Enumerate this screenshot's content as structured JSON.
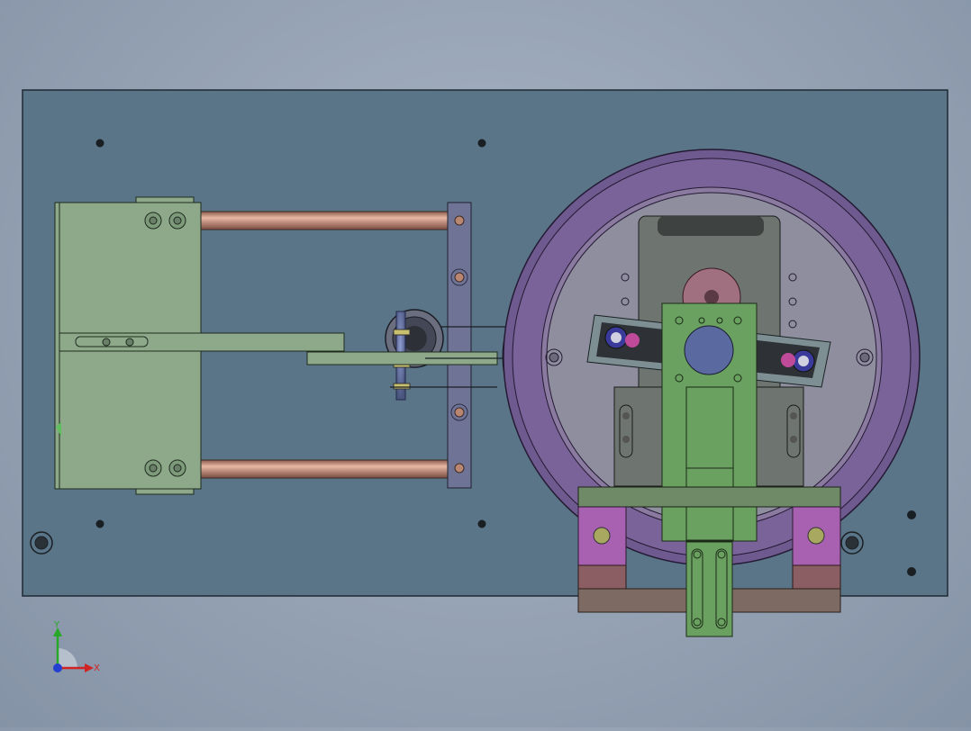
{
  "viewport": {
    "background": "#95a2b4"
  },
  "colors": {
    "plate": "#5a7488",
    "block": "#8da98a",
    "rod": "#b98672",
    "bracket": "#6f7396",
    "ring_outer": "#6e5a8e",
    "ring_inner": "#8a7aa0",
    "disc": "#8f8e9e",
    "motor": "#6e7470",
    "link": "#6aa060",
    "clamp": "#8e5a9a",
    "base": "#7d6a62"
  },
  "triad": {
    "y_label": "Y",
    "x_label": "X",
    "icons": [
      "y-axis-arrow-icon",
      "x-axis-arrow-icon",
      "z-axis-dot-icon"
    ]
  }
}
